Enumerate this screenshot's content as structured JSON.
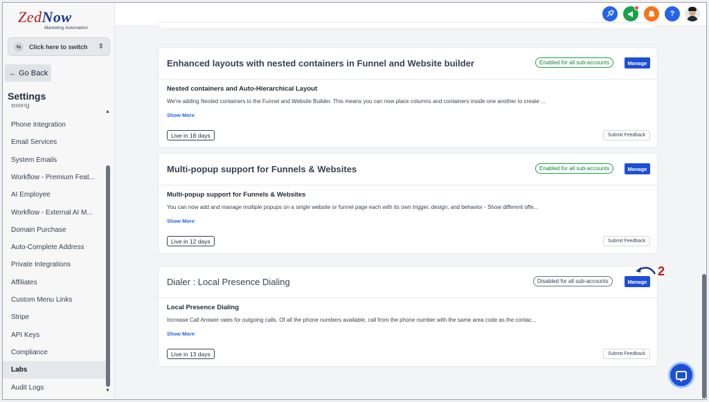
{
  "brand": {
    "name_a": "Zed",
    "name_b": "Now",
    "tagline": "Marketing Automation"
  },
  "switcher": {
    "label": "Click here to switch"
  },
  "sidebar": {
    "back_label": "← Go Back",
    "title": "Settings",
    "cutoff_item": "Billing",
    "items": [
      {
        "label": "Phone Integration",
        "active": false
      },
      {
        "label": "Email Services",
        "active": false
      },
      {
        "label": "System Emails",
        "active": false
      },
      {
        "label": "Workflow - Premium Feat...",
        "active": false
      },
      {
        "label": "AI Employee",
        "active": false
      },
      {
        "label": "Workflow - External AI M...",
        "active": false
      },
      {
        "label": "Domain Purchase",
        "active": false
      },
      {
        "label": "Auto-Complete Address",
        "active": false
      },
      {
        "label": "Private Integrations",
        "active": false
      },
      {
        "label": "Affiliates",
        "active": false
      },
      {
        "label": "Custom Menu Links",
        "active": false
      },
      {
        "label": "Stripe",
        "active": false
      },
      {
        "label": "API Keys",
        "active": false
      },
      {
        "label": "Compliance",
        "active": false
      },
      {
        "label": "Labs",
        "active": true
      },
      {
        "label": "Audit Logs",
        "active": false
      }
    ]
  },
  "topbar": {
    "icons": [
      {
        "name": "rocket-icon",
        "color": "#2563eb",
        "glyph": "✈"
      },
      {
        "name": "megaphone-icon",
        "color": "#16a34a",
        "glyph": "📢"
      },
      {
        "name": "bell-icon",
        "color": "#f97316",
        "glyph": "🔔"
      },
      {
        "name": "help-icon",
        "color": "#2563eb",
        "glyph": "?"
      }
    ]
  },
  "cards": [
    {
      "title": "Enhanced layouts with nested containers in Funnel and Website builder",
      "status": "Enabled for all sub-accounts",
      "status_type": "enabled",
      "manage": "Manage",
      "subtitle": "Nested containers and Auto-Hierarchical Layout",
      "description": "We're adding Nested containers to the Funnel and Website Builder. This means you can now place columns and containers inside one another to create ...",
      "show_more": "Show More",
      "live": "Live in 18 days",
      "feedback": "Submit Feedback"
    },
    {
      "title": "Multi-popup support for Funnels & Websites",
      "status": "Enabled for all sub-accounts",
      "status_type": "enabled",
      "manage": "Manage",
      "subtitle": "Multi-popup support for Funnels & Websites",
      "description": "You can now add and manage multiple popups on a single website or funnel page each with its own trigger, design, and behavior - Show different offe...",
      "show_more": "Show More",
      "live": "Live in 12 days",
      "feedback": "Submit Feedback"
    },
    {
      "title": "Dialer : Local Presence Dialing",
      "status": "Disabled for all sub-accounts",
      "status_type": "disabled",
      "manage": "Manage",
      "subtitle": "Local Presence Dialing",
      "description": "Increase Call Answer rates for outgoing calls. Of all the phone numbers available, call from the phone number with the same area code as the contac...",
      "show_more": "Show More",
      "live": "Live in 13 days",
      "feedback": "Submit Feedback"
    }
  ],
  "annotation": {
    "step": "2",
    "color": "#b91c1c"
  }
}
